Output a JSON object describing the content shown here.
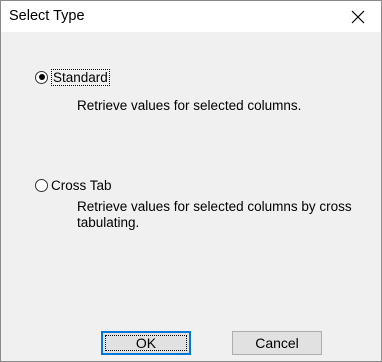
{
  "dialog": {
    "title": "Select Type",
    "close_icon": "close-icon"
  },
  "options": [
    {
      "label": "Standard",
      "checked": true,
      "description": "Retrieve values for selected columns."
    },
    {
      "label": "Cross Tab",
      "checked": false,
      "description": "Retrieve values for selected columns by cross tabulating."
    }
  ],
  "buttons": {
    "ok_label": "OK",
    "cancel_label": "Cancel"
  },
  "colors": {
    "accent": "#0078d7",
    "background": "#f0f0f0"
  }
}
